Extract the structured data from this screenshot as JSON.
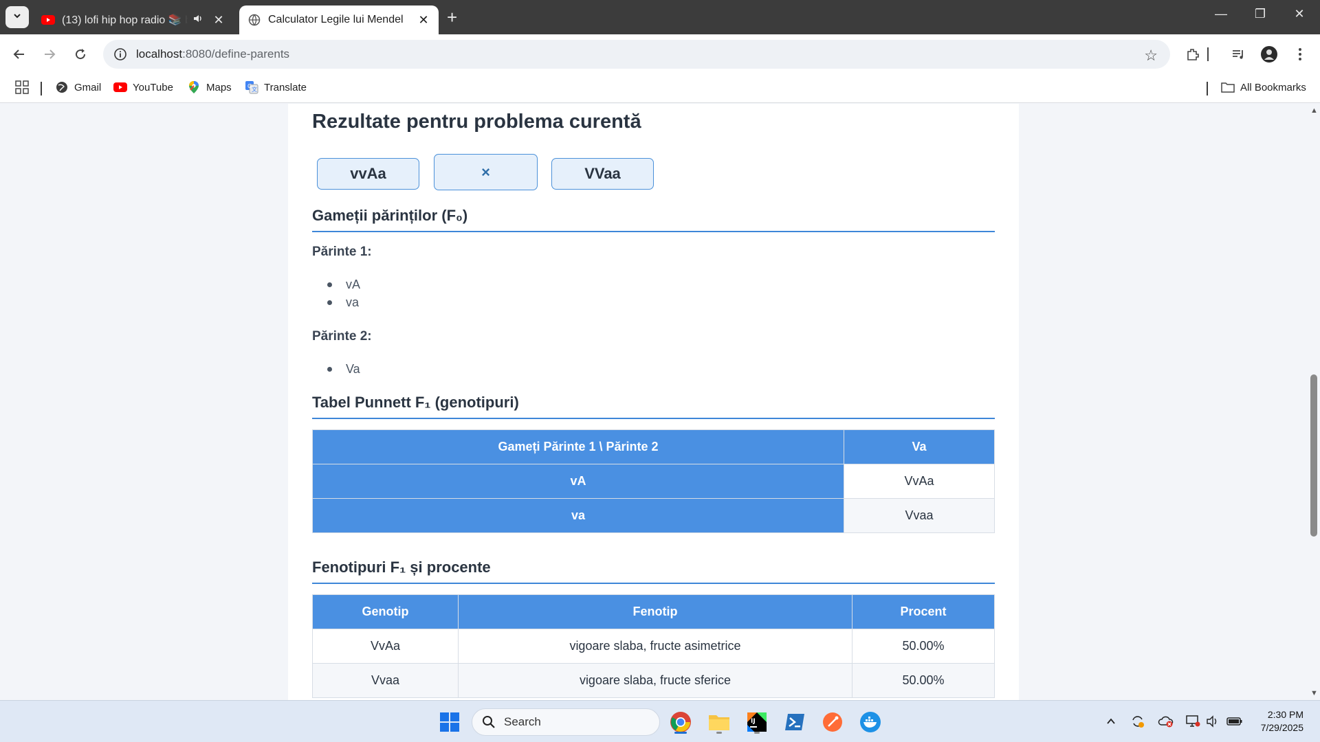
{
  "browser": {
    "tabs": [
      {
        "title": "(13) lofi hip hop radio 📚 beats to relax/study to",
        "active": false,
        "audio": true
      },
      {
        "title": "Calculator Legile lui Mendel",
        "active": true
      }
    ],
    "url_host": "localhost",
    "url_path": ":8080/define-parents",
    "bookmarks": [
      "Gmail",
      "YouTube",
      "Maps",
      "Translate"
    ],
    "all_bookmarks_label": "All Bookmarks"
  },
  "page": {
    "title": "Rezultate pentru problema curentă",
    "cross": {
      "parent1": "vvAa",
      "symbol": "×",
      "parent2": "VVaa"
    },
    "gametes": {
      "heading": "Gameții părinților (F₀)",
      "parent1_label": "Părinte 1:",
      "parent1_gametes": [
        "vA",
        "va"
      ],
      "parent2_label": "Părinte 2:",
      "parent2_gametes": [
        "Va"
      ]
    },
    "punnett": {
      "heading": "Tabel Punnett F₁ (genotipuri)",
      "corner": "Gameți Părinte 1 \\ Părinte 2",
      "col_headers": [
        "Va"
      ],
      "rows": [
        {
          "gamete": "vA",
          "cells": [
            "VvAa"
          ]
        },
        {
          "gamete": "va",
          "cells": [
            "Vvaa"
          ]
        }
      ]
    },
    "phenotypes": {
      "heading": "Fenotipuri F₁ și procente",
      "headers": [
        "Genotip",
        "Fenotip",
        "Procent"
      ],
      "rows": [
        [
          "VvAa",
          "vigoare slaba, fructe asimetrice",
          "50.00%"
        ],
        [
          "Vvaa",
          "vigoare slaba, fructe sferice",
          "50.00%"
        ]
      ]
    }
  },
  "taskbar": {
    "search_placeholder": "Search",
    "time": "2:30 PM",
    "date": "7/29/2025"
  }
}
